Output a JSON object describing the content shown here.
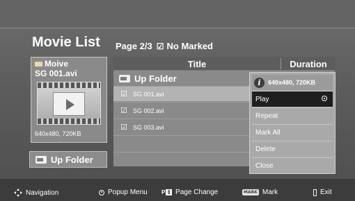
{
  "header": {
    "title": "Movie List",
    "page_info": "Page 2/3",
    "check_glyph": "☑",
    "marked_status": "No Marked"
  },
  "preview": {
    "folder_name": "Moive",
    "file_name": "SG 001.avi",
    "thumbnail_icon": "film-play-icon",
    "resolution": "640x480, 720KB"
  },
  "up_folder_button": {
    "label": "Up Folder",
    "icon": "folder-up-icon"
  },
  "list": {
    "columns": {
      "title": "Title",
      "duration": "Duration"
    },
    "up_folder_label": "Up Folder",
    "files": [
      {
        "check": "☑",
        "name": "SG 001.avi",
        "selected": true
      },
      {
        "check": "☑",
        "name": "SG 002.avi",
        "selected": false
      },
      {
        "check": "☑",
        "name": "SG 003.avi",
        "selected": false
      }
    ]
  },
  "popup": {
    "info": "640x480, 720KB",
    "items": [
      {
        "label": "Play",
        "active": true
      },
      {
        "label": "Repeat",
        "active": false
      },
      {
        "label": "Mark All",
        "active": false
      },
      {
        "label": "Delete",
        "active": false
      },
      {
        "label": "Close",
        "active": false
      }
    ]
  },
  "footer": {
    "navigation": "Navigation",
    "popup_menu": "Popup Menu",
    "page_icon_text": "P",
    "page_icon_arrows": "⇕",
    "page_change": "Page Change",
    "mark_icon_text": "MARK",
    "mark": "Mark",
    "exit": "Exit"
  },
  "colors": {
    "background": "#5c5c5c",
    "selected_row": "#b3b3b3",
    "active_menu": "#1f1f1f",
    "bottom_bar": "#3c3c3c"
  }
}
